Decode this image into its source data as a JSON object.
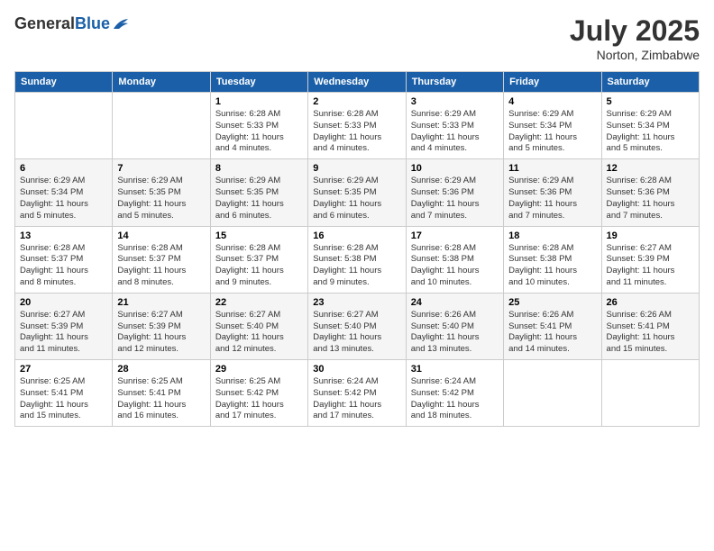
{
  "header": {
    "logo_general": "General",
    "logo_blue": "Blue",
    "month_year": "July 2025",
    "location": "Norton, Zimbabwe"
  },
  "days_of_week": [
    "Sunday",
    "Monday",
    "Tuesday",
    "Wednesday",
    "Thursday",
    "Friday",
    "Saturday"
  ],
  "weeks": [
    [
      {
        "day": "",
        "detail": ""
      },
      {
        "day": "",
        "detail": ""
      },
      {
        "day": "1",
        "detail": "Sunrise: 6:28 AM\nSunset: 5:33 PM\nDaylight: 11 hours\nand 4 minutes."
      },
      {
        "day": "2",
        "detail": "Sunrise: 6:28 AM\nSunset: 5:33 PM\nDaylight: 11 hours\nand 4 minutes."
      },
      {
        "day": "3",
        "detail": "Sunrise: 6:29 AM\nSunset: 5:33 PM\nDaylight: 11 hours\nand 4 minutes."
      },
      {
        "day": "4",
        "detail": "Sunrise: 6:29 AM\nSunset: 5:34 PM\nDaylight: 11 hours\nand 5 minutes."
      },
      {
        "day": "5",
        "detail": "Sunrise: 6:29 AM\nSunset: 5:34 PM\nDaylight: 11 hours\nand 5 minutes."
      }
    ],
    [
      {
        "day": "6",
        "detail": "Sunrise: 6:29 AM\nSunset: 5:34 PM\nDaylight: 11 hours\nand 5 minutes."
      },
      {
        "day": "7",
        "detail": "Sunrise: 6:29 AM\nSunset: 5:35 PM\nDaylight: 11 hours\nand 5 minutes."
      },
      {
        "day": "8",
        "detail": "Sunrise: 6:29 AM\nSunset: 5:35 PM\nDaylight: 11 hours\nand 6 minutes."
      },
      {
        "day": "9",
        "detail": "Sunrise: 6:29 AM\nSunset: 5:35 PM\nDaylight: 11 hours\nand 6 minutes."
      },
      {
        "day": "10",
        "detail": "Sunrise: 6:29 AM\nSunset: 5:36 PM\nDaylight: 11 hours\nand 7 minutes."
      },
      {
        "day": "11",
        "detail": "Sunrise: 6:29 AM\nSunset: 5:36 PM\nDaylight: 11 hours\nand 7 minutes."
      },
      {
        "day": "12",
        "detail": "Sunrise: 6:28 AM\nSunset: 5:36 PM\nDaylight: 11 hours\nand 7 minutes."
      }
    ],
    [
      {
        "day": "13",
        "detail": "Sunrise: 6:28 AM\nSunset: 5:37 PM\nDaylight: 11 hours\nand 8 minutes."
      },
      {
        "day": "14",
        "detail": "Sunrise: 6:28 AM\nSunset: 5:37 PM\nDaylight: 11 hours\nand 8 minutes."
      },
      {
        "day": "15",
        "detail": "Sunrise: 6:28 AM\nSunset: 5:37 PM\nDaylight: 11 hours\nand 9 minutes."
      },
      {
        "day": "16",
        "detail": "Sunrise: 6:28 AM\nSunset: 5:38 PM\nDaylight: 11 hours\nand 9 minutes."
      },
      {
        "day": "17",
        "detail": "Sunrise: 6:28 AM\nSunset: 5:38 PM\nDaylight: 11 hours\nand 10 minutes."
      },
      {
        "day": "18",
        "detail": "Sunrise: 6:28 AM\nSunset: 5:38 PM\nDaylight: 11 hours\nand 10 minutes."
      },
      {
        "day": "19",
        "detail": "Sunrise: 6:27 AM\nSunset: 5:39 PM\nDaylight: 11 hours\nand 11 minutes."
      }
    ],
    [
      {
        "day": "20",
        "detail": "Sunrise: 6:27 AM\nSunset: 5:39 PM\nDaylight: 11 hours\nand 11 minutes."
      },
      {
        "day": "21",
        "detail": "Sunrise: 6:27 AM\nSunset: 5:39 PM\nDaylight: 11 hours\nand 12 minutes."
      },
      {
        "day": "22",
        "detail": "Sunrise: 6:27 AM\nSunset: 5:40 PM\nDaylight: 11 hours\nand 12 minutes."
      },
      {
        "day": "23",
        "detail": "Sunrise: 6:27 AM\nSunset: 5:40 PM\nDaylight: 11 hours\nand 13 minutes."
      },
      {
        "day": "24",
        "detail": "Sunrise: 6:26 AM\nSunset: 5:40 PM\nDaylight: 11 hours\nand 13 minutes."
      },
      {
        "day": "25",
        "detail": "Sunrise: 6:26 AM\nSunset: 5:41 PM\nDaylight: 11 hours\nand 14 minutes."
      },
      {
        "day": "26",
        "detail": "Sunrise: 6:26 AM\nSunset: 5:41 PM\nDaylight: 11 hours\nand 15 minutes."
      }
    ],
    [
      {
        "day": "27",
        "detail": "Sunrise: 6:25 AM\nSunset: 5:41 PM\nDaylight: 11 hours\nand 15 minutes."
      },
      {
        "day": "28",
        "detail": "Sunrise: 6:25 AM\nSunset: 5:41 PM\nDaylight: 11 hours\nand 16 minutes."
      },
      {
        "day": "29",
        "detail": "Sunrise: 6:25 AM\nSunset: 5:42 PM\nDaylight: 11 hours\nand 17 minutes."
      },
      {
        "day": "30",
        "detail": "Sunrise: 6:24 AM\nSunset: 5:42 PM\nDaylight: 11 hours\nand 17 minutes."
      },
      {
        "day": "31",
        "detail": "Sunrise: 6:24 AM\nSunset: 5:42 PM\nDaylight: 11 hours\nand 18 minutes."
      },
      {
        "day": "",
        "detail": ""
      },
      {
        "day": "",
        "detail": ""
      }
    ]
  ]
}
